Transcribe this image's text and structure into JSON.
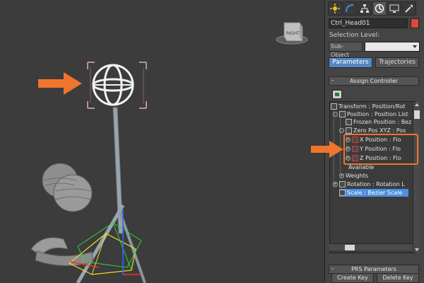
{
  "viewport": {
    "cube_label": "RIGHT"
  },
  "toolbar": {
    "icons": [
      "create-icon",
      "modify-icon",
      "hierarchy-icon",
      "motion-icon",
      "display-icon",
      "utilities-icon"
    ],
    "active_index": 3
  },
  "object": {
    "name": "Ctrl_Head01",
    "color": "#e0463d"
  },
  "selection": {
    "label": "Selection Level:",
    "button": "Sub-Object",
    "dropdown_value": ""
  },
  "mode": {
    "parameters": "Parameters",
    "trajectories": "Trajectories"
  },
  "assign_controller": {
    "title": "Assign Controller",
    "collapse": "-"
  },
  "tree": {
    "items": [
      {
        "label": "Transform : Position/Rot"
      },
      {
        "label": "Position : Position List"
      },
      {
        "label": "Frozen Position : Bez"
      },
      {
        "label": "Zero Pos XYZ : Pos"
      },
      {
        "label": "X Position : Flo"
      },
      {
        "label": "Y Position : Flo"
      },
      {
        "label": "Z Position : Flo"
      },
      {
        "label": "Available"
      },
      {
        "label": "Weights"
      },
      {
        "label": "Rotation : Rotation L"
      },
      {
        "label": "Scale : Bezier Scale"
      }
    ],
    "selected_index": 10
  },
  "prs": {
    "title": "PRS Parameters",
    "collapse": "-",
    "create_key": "Create Key",
    "delete_key": "Delete Key"
  },
  "colors": {
    "accent_blue": "#5586c4",
    "highlight_orange": "#f0742c",
    "selection_blue": "#4d8fe0"
  }
}
